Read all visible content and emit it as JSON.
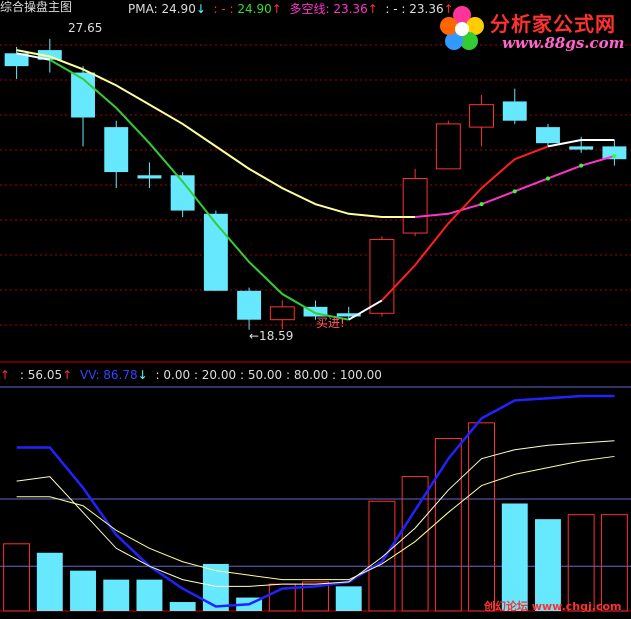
{
  "header": {
    "title": "综合操盘主图",
    "pma_label": "PMA:",
    "pma_value": "24.90",
    "pma_arrow": "↓",
    "s2_prefix": ": - :",
    "s2_value": "24.90",
    "s2_arrow": "↑",
    "dk_label": "多空线:",
    "dk_value": "23.36",
    "dk_arrow": "↑",
    "s4_prefix": ": - :",
    "s4_value": "23.36",
    "s4_arrow": "↑"
  },
  "sub_header": {
    "up_arrow": "↑",
    "v1": ": 56.05",
    "v1_arrow": "↑",
    "vv_label": "VV: 86.78",
    "vv_arrow": "↓",
    "levels": ": 0.00 : 20.00 : 50.00 : 80.00 : 100.00"
  },
  "logo": {
    "title": "分析家公式网",
    "url": "www.88gs.com"
  },
  "watermark": "创幻论坛 www.chgj.com",
  "annotations": {
    "high": "27.65",
    "low": "←18.59",
    "buy": "买进!"
  },
  "colors": {
    "up": "#ff3030",
    "down": "#66e8ff",
    "yellow_line": "#ffff99",
    "green_line": "#33cc33",
    "red_line": "#ff2020",
    "magenta_line": "#ff33cc",
    "blue_line": "#2222ff",
    "grid": "#aa0000"
  },
  "chart_data": [
    {
      "type": "candlestick",
      "title": "综合操盘主图",
      "ylim": [
        17.8,
        28.3
      ],
      "candles": [
        {
          "open": 27.2,
          "close": 26.8,
          "high": 27.4,
          "low": 26.4
        },
        {
          "open": 27.3,
          "close": 27.0,
          "high": 27.65,
          "low": 26.6
        },
        {
          "open": 26.6,
          "close": 25.2,
          "high": 26.8,
          "low": 24.3
        },
        {
          "open": 24.9,
          "close": 23.5,
          "high": 25.1,
          "low": 23.0
        },
        {
          "open": 23.4,
          "close": 23.3,
          "high": 23.8,
          "low": 23.0
        },
        {
          "open": 23.4,
          "close": 22.3,
          "high": 23.5,
          "low": 22.1
        },
        {
          "open": 22.2,
          "close": 19.8,
          "high": 22.3,
          "low": 19.8
        },
        {
          "open": 19.8,
          "close": 18.9,
          "high": 19.9,
          "low": 18.59
        },
        {
          "open": 18.9,
          "close": 19.3,
          "high": 19.5,
          "low": 18.6
        },
        {
          "open": 19.3,
          "close": 19.0,
          "high": 19.5,
          "low": 18.9
        },
        {
          "open": 19.1,
          "close": 19.0,
          "high": 19.3,
          "low": 18.9
        },
        {
          "open": 19.1,
          "close": 21.4,
          "high": 21.5,
          "low": 19.0
        },
        {
          "open": 21.6,
          "close": 23.3,
          "high": 23.6,
          "low": 21.5
        },
        {
          "open": 23.6,
          "close": 25.0,
          "high": 25.1,
          "low": 23.6
        },
        {
          "open": 24.9,
          "close": 25.6,
          "high": 25.9,
          "low": 24.3
        },
        {
          "open": 25.7,
          "close": 25.1,
          "high": 26.1,
          "low": 25.0
        },
        {
          "open": 24.9,
          "close": 24.4,
          "high": 25.0,
          "low": 24.3
        },
        {
          "open": 24.3,
          "close": 24.2,
          "high": 24.6,
          "low": 24.1
        },
        {
          "open": 24.3,
          "close": 23.9,
          "high": 24.5,
          "low": 23.7
        }
      ],
      "series": [
        {
          "name": "PMA",
          "color": "#ffff99",
          "values": [
            27.3,
            27.1,
            26.7,
            26.2,
            25.6,
            25.0,
            24.3,
            23.6,
            23.0,
            22.5,
            22.2,
            22.1,
            22.1,
            22.2,
            22.5,
            22.9,
            23.3,
            23.7,
            24.0
          ]
        },
        {
          "name": "多空线",
          "color": "#33cc33",
          "values": [
            27.2,
            27.0,
            26.4,
            25.5,
            24.4,
            23.2,
            21.9,
            20.7,
            19.7,
            19.1,
            18.9,
            19.5,
            20.6,
            21.9,
            23.0,
            23.9,
            24.3,
            24.5,
            24.5
          ]
        }
      ]
    },
    {
      "type": "bar",
      "ylim": [
        0,
        100
      ],
      "levels": [
        0,
        20,
        50,
        80,
        100
      ],
      "values": [
        30,
        26,
        18,
        14,
        14,
        4,
        21,
        6,
        12,
        13,
        11,
        49,
        60,
        77,
        84,
        48,
        41,
        43,
        43
      ],
      "direction": [
        "up",
        "down",
        "down",
        "down",
        "down",
        "down",
        "down",
        "down",
        "up",
        "up",
        "down",
        "up",
        "up",
        "up",
        "up",
        "down",
        "down",
        "up",
        "up"
      ],
      "series": [
        {
          "name": "VV",
          "color": "#2222ff",
          "values": [
            73,
            73,
            55,
            34,
            20,
            10,
            2,
            3,
            10,
            11,
            13,
            22,
            45,
            68,
            86,
            94,
            95,
            96,
            96
          ]
        },
        {
          "color": "#ffffcc",
          "values": [
            58,
            60,
            44,
            28,
            20,
            14,
            11,
            11,
            12,
            12,
            13,
            24,
            37,
            54,
            68,
            72,
            74,
            75,
            76
          ]
        },
        {
          "color": "#ffff99",
          "values": [
            51,
            51,
            47,
            36,
            28,
            22,
            18,
            16,
            14,
            14,
            14,
            21,
            31,
            44,
            56,
            61,
            64,
            67,
            69
          ]
        }
      ]
    }
  ]
}
